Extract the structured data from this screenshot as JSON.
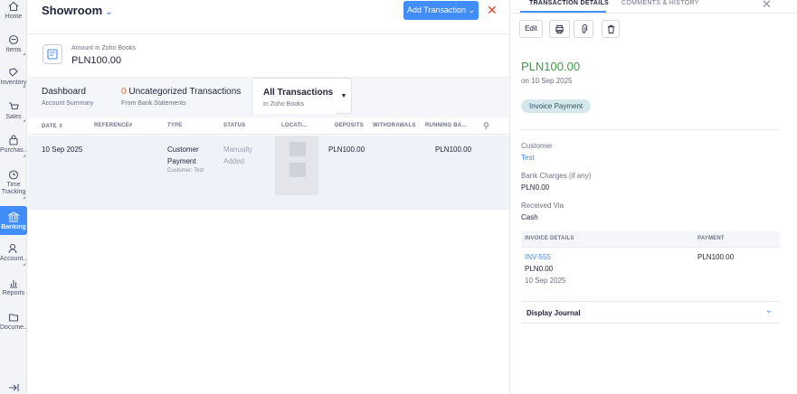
{
  "nav": {
    "items": [
      {
        "label": "Home",
        "icon": "home-icon"
      },
      {
        "label": "Items",
        "icon": "items-icon"
      },
      {
        "label": "Inventory",
        "icon": "inventory-icon"
      },
      {
        "label": "Sales",
        "icon": "sales-icon"
      },
      {
        "label": "Purchas...",
        "icon": "purchases-icon"
      },
      {
        "label": "Time Tracking",
        "icon": "time-tracking-icon"
      },
      {
        "label": "Banking",
        "icon": "banking-icon"
      },
      {
        "label": "Account...",
        "icon": "accountant-icon"
      },
      {
        "label": "Reports",
        "icon": "reports-icon"
      },
      {
        "label": "Docume...",
        "icon": "documents-icon"
      }
    ],
    "collapse_icon": "collapse-icon"
  },
  "header": {
    "title": "Showroom",
    "add_button": "Add Transaction"
  },
  "account": {
    "amount_label": "Amount in Zoho Books",
    "amount_value": "PLN100.00"
  },
  "tabs": [
    {
      "title": "Dashboard",
      "subtitle": "Account Summary"
    },
    {
      "count": "0",
      "title": "Uncategorized Transactions",
      "subtitle": "From Bank Statements"
    },
    {
      "title": "All Transactions",
      "subtitle": "In Zoho Books"
    }
  ],
  "table": {
    "columns": [
      "DATE",
      "REFERENCE#",
      "TYPE",
      "STATUS",
      "LOCATI...",
      "DEPOSITS",
      "WITHDRAWALS",
      "RUNNING BA..."
    ],
    "rows": [
      {
        "date": "10 Sep 2025",
        "reference": "",
        "type_line1": "Customer",
        "type_line2": "Payment",
        "type_sub": "Customer: Test",
        "status_line1": "Manually",
        "status_line2": "Added",
        "deposits": "PLN100.00",
        "withdrawals": "",
        "running_balance": "PLN100.00"
      }
    ]
  },
  "panel": {
    "tabs": [
      "TRANSACTION DETAILS",
      "COMMENTS & HISTORY"
    ],
    "edit_label": "Edit",
    "amount": "PLN100.00",
    "date_line": "on 10 Sep 2025",
    "type_pill": "Invoice Payment",
    "customer_label": "Customer",
    "customer_value": "Test",
    "bank_charges_label": "Bank Charges (if any)",
    "bank_charges_value": "PLN0.00",
    "received_via_label": "Received Via",
    "received_via_value": "Cash",
    "invoice_table": {
      "col1": "INVOICE DETAILS",
      "col2": "PAYMENT",
      "invoice_number": "INV-555",
      "invoice_amount": "PLN0.00",
      "invoice_date": "10 Sep 2025",
      "payment": "PLN100.00"
    },
    "display_journal": "Display Journal"
  },
  "colors": {
    "accent": "#408dfb",
    "amount_green": "#3d9b44",
    "close_red": "#e0462e",
    "uncategorized_count": "#e8742b"
  }
}
